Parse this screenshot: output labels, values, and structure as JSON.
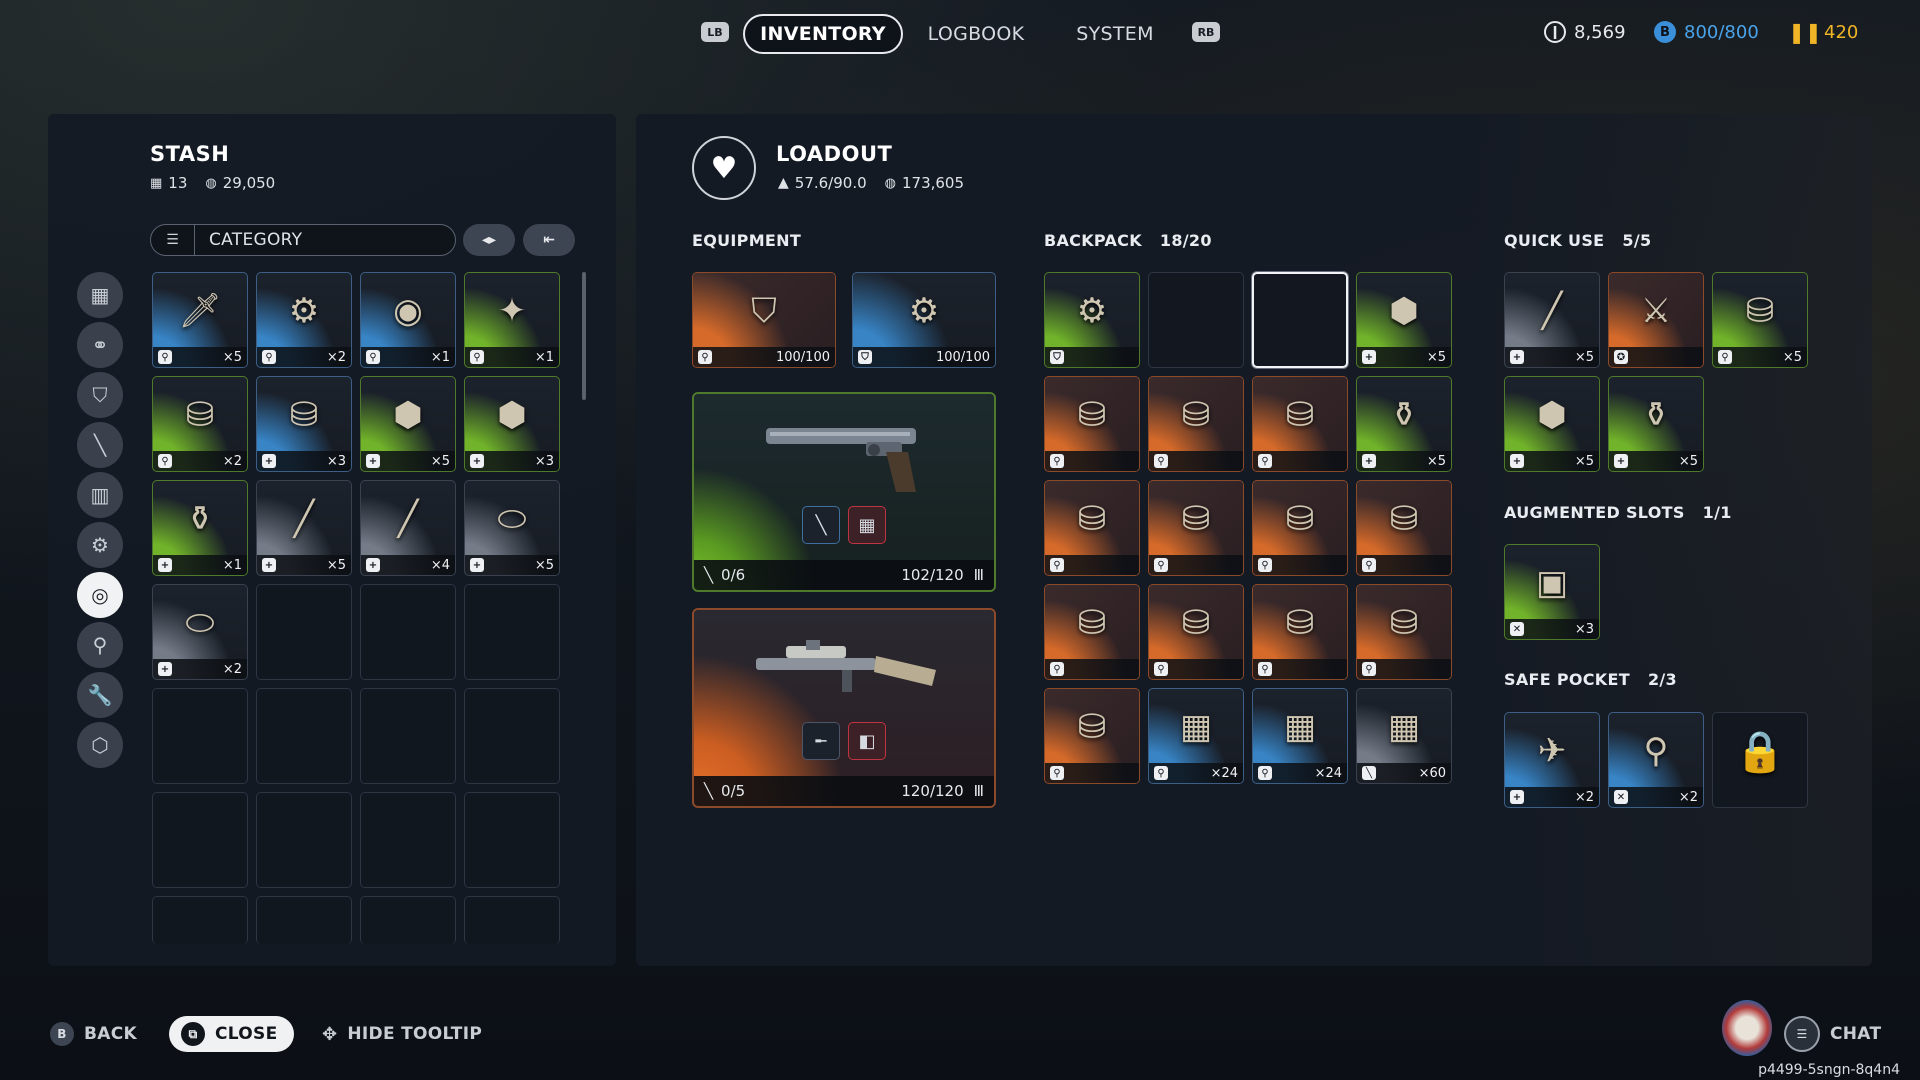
{
  "topnav": {
    "lb": "LB",
    "rb": "RB",
    "tabs": [
      "INVENTORY",
      "LOGBOOK",
      "SYSTEM"
    ],
    "active_tab": "INVENTORY"
  },
  "currency": {
    "coins": "8,569",
    "capacity": "800/800",
    "tokens": "420"
  },
  "stash": {
    "title": "STASH",
    "slots_count": "13",
    "value": "29,050",
    "filter_label": "CATEGORY",
    "items": [
      {
        "rarity": "blue",
        "glyph": "🗡",
        "type": "⚲",
        "qty": "×5"
      },
      {
        "rarity": "blue",
        "glyph": "⚙",
        "type": "⚲",
        "qty": "×2"
      },
      {
        "rarity": "blue",
        "glyph": "◉",
        "type": "⚲",
        "qty": "×1"
      },
      {
        "rarity": "green",
        "glyph": "✦",
        "type": "⚲",
        "qty": "×1"
      },
      {
        "rarity": "green",
        "glyph": "⛁",
        "type": "⚲",
        "qty": "×2"
      },
      {
        "rarity": "blue",
        "glyph": "⛁",
        "type": "+",
        "qty": "×3"
      },
      {
        "rarity": "green",
        "glyph": "⬢",
        "type": "+",
        "qty": "×5"
      },
      {
        "rarity": "green",
        "glyph": "⬢",
        "type": "+",
        "qty": "×3"
      },
      {
        "rarity": "green",
        "glyph": "⚱",
        "type": "+",
        "qty": "×1"
      },
      {
        "rarity": "gray",
        "glyph": "╱",
        "type": "+",
        "qty": "×5"
      },
      {
        "rarity": "gray",
        "glyph": "╱",
        "type": "+",
        "qty": "×4"
      },
      {
        "rarity": "gray",
        "glyph": "⬭",
        "type": "+",
        "qty": "×5"
      },
      {
        "rarity": "gray",
        "glyph": "⬭",
        "type": "+",
        "qty": "×2"
      }
    ]
  },
  "loadout": {
    "title": "LOADOUT",
    "weight": "57.6/90.0",
    "value": "173,605",
    "equipment_label": "EQUIPMENT",
    "equipment": [
      {
        "rarity": "orange",
        "glyph": "⛉",
        "type": "⚲",
        "value": "100/100"
      },
      {
        "rarity": "blue",
        "glyph": "⚙",
        "type": "⛉",
        "value": "100/100"
      }
    ],
    "weapons": [
      {
        "rarity": "green",
        "glyph": "🔫",
        "mods": "0/6",
        "ammo": "102/120"
      },
      {
        "rarity": "orange",
        "glyph": "🔫",
        "mods": "0/5",
        "ammo": "120/120"
      }
    ]
  },
  "backpack": {
    "label": "BACKPACK",
    "count": "18/20",
    "items": [
      {
        "rarity": "green",
        "glyph": "⚙",
        "type": "⛉",
        "qty": ""
      },
      {
        "rarity": "empty"
      },
      {
        "rarity": "empty",
        "selected": true
      },
      {
        "rarity": "green",
        "glyph": "⬢",
        "type": "+",
        "qty": "×5"
      },
      {
        "rarity": "orange",
        "glyph": "⛁",
        "type": "⚲",
        "qty": ""
      },
      {
        "rarity": "orange",
        "glyph": "⛁",
        "type": "⚲",
        "qty": ""
      },
      {
        "rarity": "orange",
        "glyph": "⛁",
        "type": "⚲",
        "qty": ""
      },
      {
        "rarity": "green",
        "glyph": "⚱",
        "type": "+",
        "qty": "×5"
      },
      {
        "rarity": "orange",
        "glyph": "⛁",
        "type": "⚲",
        "qty": ""
      },
      {
        "rarity": "orange",
        "glyph": "⛁",
        "type": "⚲",
        "qty": ""
      },
      {
        "rarity": "orange",
        "glyph": "⛁",
        "type": "⚲",
        "qty": ""
      },
      {
        "rarity": "orange",
        "glyph": "⛁",
        "type": "⚲",
        "qty": ""
      },
      {
        "rarity": "orange",
        "glyph": "⛁",
        "type": "⚲",
        "qty": ""
      },
      {
        "rarity": "orange",
        "glyph": "⛁",
        "type": "⚲",
        "qty": ""
      },
      {
        "rarity": "orange",
        "glyph": "⛁",
        "type": "⚲",
        "qty": ""
      },
      {
        "rarity": "orange",
        "glyph": "⛁",
        "type": "⚲",
        "qty": ""
      },
      {
        "rarity": "orange",
        "glyph": "⛁",
        "type": "⚲",
        "qty": ""
      },
      {
        "rarity": "blue",
        "glyph": "▦",
        "type": "⚲",
        "qty": "×24"
      },
      {
        "rarity": "blue",
        "glyph": "▦",
        "type": "⚲",
        "qty": "×24"
      },
      {
        "rarity": "gray",
        "glyph": "▦",
        "type": "╲",
        "qty": "×60"
      }
    ]
  },
  "quick_use": {
    "label": "QUICK USE",
    "count": "5/5",
    "items": [
      {
        "rarity": "gray",
        "glyph": "╱",
        "type": "+",
        "qty": "×5"
      },
      {
        "rarity": "orange",
        "glyph": "⚔",
        "type": "✪",
        "qty": ""
      },
      {
        "rarity": "green",
        "glyph": "⛁",
        "type": "⚲",
        "qty": "×5"
      },
      {
        "rarity": "green",
        "glyph": "⬢",
        "type": "+",
        "qty": "×5"
      },
      {
        "rarity": "green",
        "glyph": "⚱",
        "type": "+",
        "qty": "×5"
      }
    ]
  },
  "augmented": {
    "label": "AUGMENTED SLOTS",
    "count": "1/1",
    "items": [
      {
        "rarity": "green",
        "glyph": "▣",
        "type": "✕",
        "qty": "×3"
      }
    ]
  },
  "safe_pocket": {
    "label": "SAFE POCKET",
    "count": "2/3",
    "items": [
      {
        "rarity": "blue",
        "glyph": "✈",
        "type": "+",
        "qty": "×2"
      },
      {
        "rarity": "blue",
        "glyph": "⚲",
        "type": "✕",
        "qty": "×2"
      },
      {
        "rarity": "lock",
        "glyph": "🔒"
      }
    ]
  },
  "footer": {
    "back_key": "B",
    "back": "BACK",
    "close": "CLOSE",
    "hide_tooltip": "HIDE TOOLTIP",
    "chat": "CHAT",
    "session_id": "p4499-5sngn-8q4n4"
  }
}
